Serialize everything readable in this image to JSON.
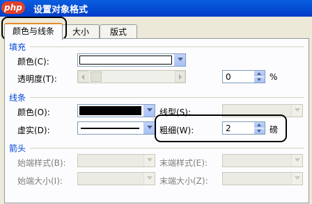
{
  "window": {
    "title": "设置对象格式",
    "watermark": "php"
  },
  "tabs": [
    {
      "label": "颜色与线条",
      "active": true
    },
    {
      "label": "大小",
      "active": false
    },
    {
      "label": "版式",
      "active": false
    }
  ],
  "fill": {
    "section": "填充",
    "color_label": "颜色(C):",
    "color_value": "#ffffff",
    "transparency_label": "透明度(T):",
    "transparency_value": "0",
    "transparency_unit": "%"
  },
  "line": {
    "section": "线条",
    "color_label": "颜色(O):",
    "color_value": "#000000",
    "style_label": "线型(S):",
    "dash_label": "虚实(D):",
    "weight_label": "粗细(W):",
    "weight_value": "2",
    "weight_unit": "磅"
  },
  "arrows": {
    "section": "箭头",
    "begin_style_label": "始端样式(B):",
    "end_style_label": "末端样式(E):",
    "begin_size_label": "始端大小(I):",
    "end_size_label": "末端大小(Z):"
  },
  "colors": {
    "titlebar": "#0a5ee0",
    "section": "#0046d5",
    "highlight": "#000000"
  }
}
